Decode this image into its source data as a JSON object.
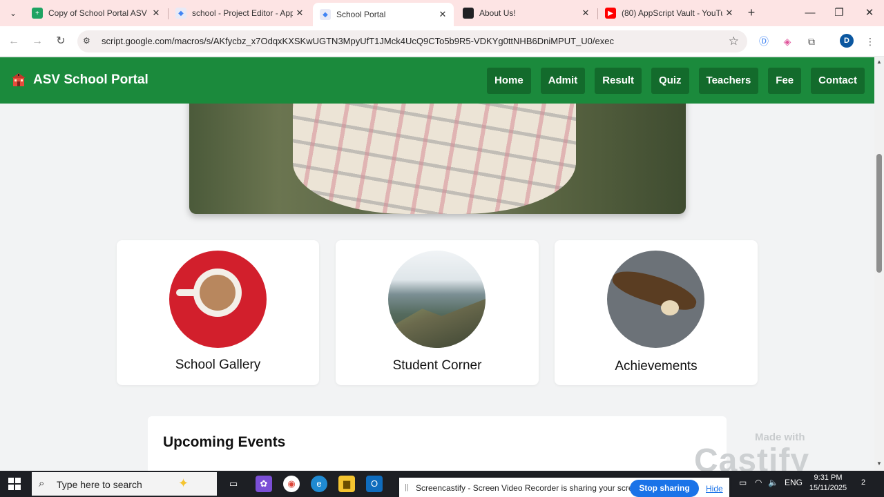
{
  "browser": {
    "tabs": [
      {
        "title": "Copy of School Portal ASV -",
        "favicon_color": "#1ea362",
        "active": false
      },
      {
        "title": "school - Project Editor - App",
        "favicon_color": "#4285f4",
        "active": false
      },
      {
        "title": "School Portal",
        "favicon_color": "#4285f4",
        "active": true
      },
      {
        "title": "About Us!",
        "favicon_color": "#202124",
        "active": false
      },
      {
        "title": "(80) AppScript Vault - YouTu",
        "favicon_color": "#ff0000",
        "active": false
      }
    ],
    "url": "script.google.com/macros/s/AKfycbz_x7OdqxKXSKwUGTN3MpyUfT1JMck4UcQ9CTo5b9R5-VDKYg0ttNHB6DniMPUT_U0/exec",
    "profile_initial": "D"
  },
  "site": {
    "brand": "ASV School Portal",
    "accent": "#1b8a3c",
    "nav": [
      "Home",
      "Admit",
      "Result",
      "Quiz",
      "Teachers",
      "Fee",
      "Contact"
    ],
    "cards": [
      {
        "label": "School Gallery",
        "image": "coffee-cup"
      },
      {
        "label": "Student Corner",
        "image": "mountain"
      },
      {
        "label": "Achievements",
        "image": "eagle"
      }
    ],
    "events_heading": "Upcoming Events"
  },
  "watermark": {
    "made_with": "Made with",
    "brand": "Castify"
  },
  "taskbar": {
    "search_placeholder": "Type here to search",
    "share_message": "Screencastify - Screen Video Recorder is sharing your screen.",
    "stop_label": "Stop sharing",
    "hide_label": "Hide",
    "language": "ENG",
    "time": "9:31 PM",
    "date": "15/11/2025",
    "notification_count": "2"
  }
}
